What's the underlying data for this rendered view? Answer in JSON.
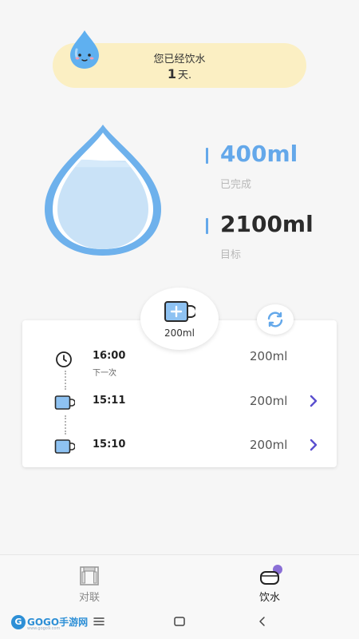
{
  "banner": {
    "text": "您已经饮水",
    "days_value": "1",
    "days_unit": "天."
  },
  "progress": {
    "completed_value": "400ml",
    "completed_label": "已完成",
    "target_value": "2100ml",
    "target_label": "目标",
    "fraction": 0.19
  },
  "add_button": {
    "amount": "200ml"
  },
  "records": [
    {
      "time": "16:00",
      "sub": "下一次",
      "amount": "200ml",
      "icon": "clock-icon"
    },
    {
      "time": "15:11",
      "amount": "200ml",
      "icon": "cup-icon"
    },
    {
      "time": "15:10",
      "amount": "200ml",
      "icon": "cup-icon"
    }
  ],
  "nav": {
    "items": [
      {
        "label": "对联",
        "icon": "couplet-icon",
        "active": false
      },
      {
        "label": "饮水",
        "icon": "mug-icon",
        "active": true
      }
    ]
  },
  "watermark": {
    "brand": "GOGO手游网",
    "url": "www.gogo9.com"
  },
  "colors": {
    "accent": "#64a8ea",
    "drop_fill": "#c9e2f7",
    "banner_bg": "#fbefc3",
    "chevron": "#5a4fcf"
  }
}
